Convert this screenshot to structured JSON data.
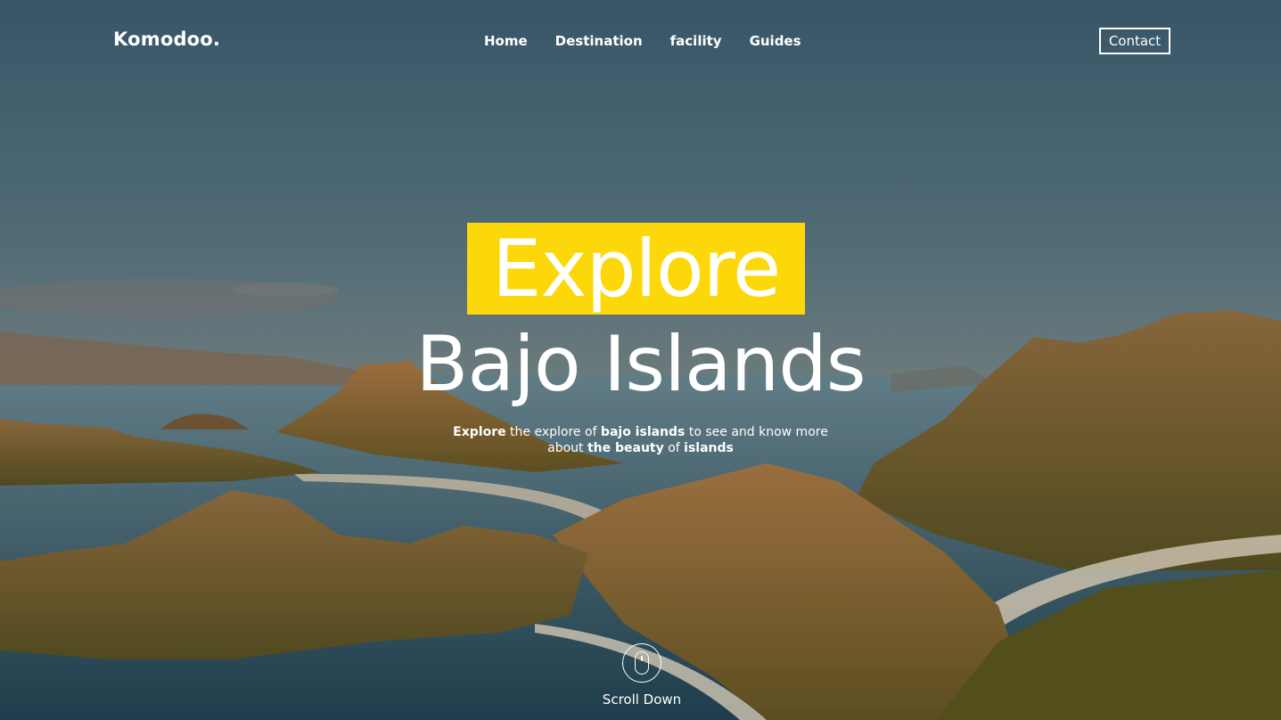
{
  "brand": {
    "logo": "Komodoo."
  },
  "nav": {
    "items": [
      {
        "label": "Home"
      },
      {
        "label": "Destination"
      },
      {
        "label": "facility"
      },
      {
        "label": "Guides"
      }
    ],
    "contact_label": "Contact"
  },
  "hero": {
    "highlight_word": "Explore",
    "title": "Bajo Islands",
    "subtitle": {
      "line1": {
        "w1": "Explore",
        "t1": " the explore of ",
        "w2": "bajo islands",
        "t2": " to see and know more"
      },
      "line2": {
        "t1": "about ",
        "w1": "the beauty",
        "t2": " of ",
        "w2": "islands"
      }
    },
    "scroll_label": "Scroll Down"
  },
  "colors": {
    "accent": "#FCD80A",
    "text": "#FFFFFF",
    "sky": "#4A6A80",
    "sea": "#2E5266",
    "land": "#8A6A38"
  }
}
